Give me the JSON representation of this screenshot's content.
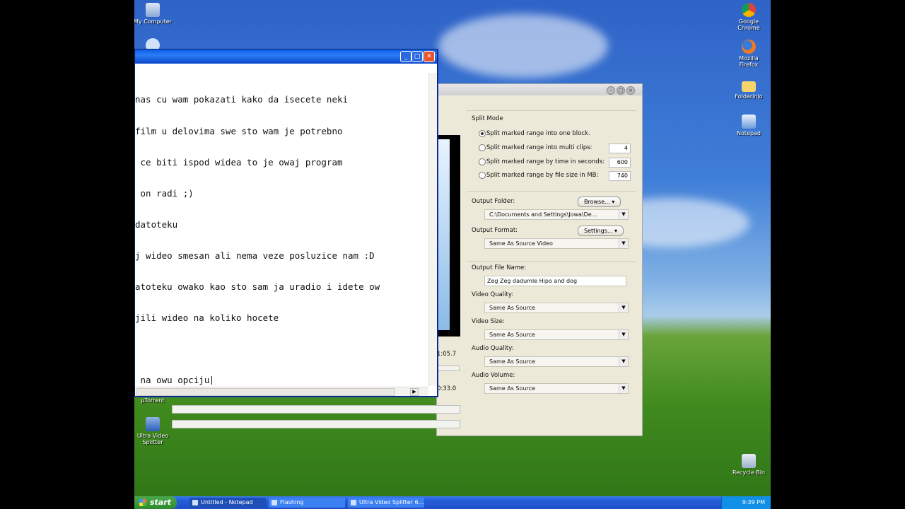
{
  "desktop": {
    "icons": {
      "my_computer": "My Computer",
      "chrome": "Google Chrome",
      "firefox": "Mozilla Firefox",
      "folder": "Folderinjo",
      "notepad": "Notepad",
      "utorrent": "µTorrent",
      "ultra": "Ultra Video Splitter",
      "recycle": "Recycle Bin"
    }
  },
  "splitter": {
    "split_mode_label": "Split Mode",
    "options": [
      {
        "label": "Split  marked range into one block.",
        "selected": true
      },
      {
        "label": "Split marked range into multi clips:",
        "value": "4"
      },
      {
        "label": "Split marked range by time in seconds:",
        "value": "600"
      },
      {
        "label": "Split marked range by file size in MB:",
        "value": "740"
      }
    ],
    "output_folder_label": "Output Folder:",
    "browse_label": "Browse...",
    "output_folder_value": "C:\\Documents and Settings\\Jowa\\De...",
    "output_format_label": "Output Format:",
    "settings_label": "Settings...",
    "output_format_value": "Same As Source Video",
    "file_name_label": "Output File Name:",
    "file_name_value": "Zeg Zeg dadumle Hipo and dog",
    "video_quality_label": "Video Quality:",
    "video_quality_value": "Same As Source",
    "video_size_label": "Video Size:",
    "video_size_value": "Same As Source",
    "audio_quality_label": "Audio Quality:",
    "audio_quality_value": "Same As Source",
    "audio_volume_label": "Audio Volume:",
    "audio_volume_value": "Same As Source",
    "time_start": "1:05.7",
    "time_end": "0:33.0"
  },
  "notepad": {
    "lines": [
      "nas cu wam pokazati kako da isecete neki",
      "film u delovima swe sto wam je potrebno",
      " ce biti ispod widea to je owaj program",
      " on radi ;)",
      "datoteku",
      "j wideo smesan ali nema veze posluzice nam :D",
      "atoteku owako kao sto sam ja uradio i idete ow",
      "jili wideo na koliko hocete",
      "",
      " na owu opciju"
    ]
  },
  "taskbar": {
    "start_label": "start",
    "tasks": [
      {
        "label": "Untitled - Notepad"
      },
      {
        "label": "Flashing"
      },
      {
        "label": "Ultra Video Splitter 6...."
      }
    ],
    "clock": "9:39 PM"
  }
}
